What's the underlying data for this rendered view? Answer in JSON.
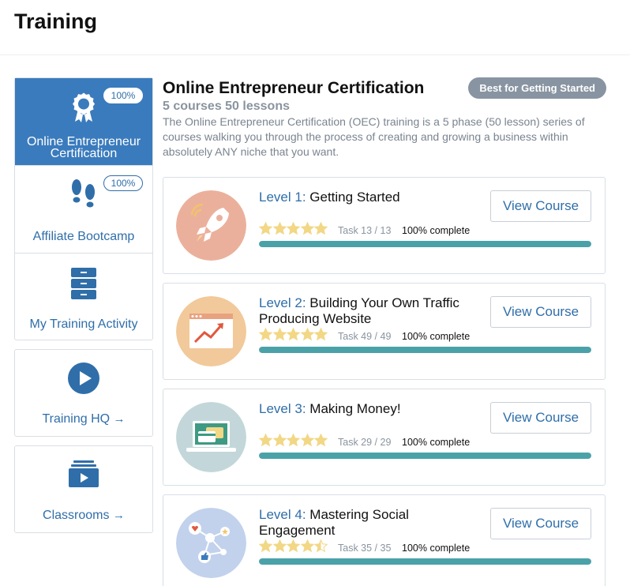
{
  "page": {
    "title": "Training"
  },
  "sidebar": {
    "items": [
      {
        "label": "Online Entrepreneur Certification",
        "badge": "100%",
        "icon": "award-ribbon-icon",
        "active": true
      },
      {
        "label": "Affiliate Bootcamp",
        "badge": "100%",
        "icon": "footprints-icon",
        "active": false
      },
      {
        "label": "My Training Activity",
        "icon": "file-cabinet-icon",
        "active": false
      }
    ],
    "links": [
      {
        "label": "Training HQ",
        "arrow": "→",
        "icon": "play-circle-icon"
      },
      {
        "label": "Classrooms",
        "arrow": "→",
        "icon": "video-stack-icon"
      }
    ]
  },
  "certification": {
    "title": "Online Entrepreneur Certification",
    "badge": "Best for Getting Started",
    "subtitle": "5 courses 50 lessons",
    "description": "The Online Entrepreneur Certification (OEC) training is a 5 phase (50 lesson) series of courses walking you through the process of creating and growing a business within absolutely ANY niche that you want."
  },
  "courses": [
    {
      "level": "Level 1:",
      "name": "Getting Started",
      "button": "View Course",
      "task": "Task 13 / 13",
      "complete": "100% complete",
      "progress": 1.0,
      "rating": 5,
      "icon": "rocket-icon",
      "icon_color": "#ebb09c"
    },
    {
      "level": "Level 2:",
      "name": "Building Your Own Traffic Producing Website",
      "button": "View Course",
      "task": "Task 49 / 49",
      "complete": "100% complete",
      "progress": 1.0,
      "rating": 5,
      "icon": "browser-chart-icon",
      "icon_color": "#f2c99a"
    },
    {
      "level": "Level 3:",
      "name": "Making Money!",
      "button": "View Course",
      "task": "Task 29 / 29",
      "complete": "100% complete",
      "progress": 1.0,
      "rating": 5,
      "icon": "laptop-card-icon",
      "icon_color": "#c3d7da"
    },
    {
      "level": "Level 4:",
      "name": "Mastering Social Engagement",
      "button": "View Course",
      "task": "Task 35 / 35",
      "complete": "100% complete",
      "progress": 1.0,
      "rating": 4.5,
      "icon": "social-network-icon",
      "icon_color": "#c2d2ec"
    }
  ],
  "colors": {
    "accent": "#3a7bbd",
    "link": "#2f6ea9",
    "progress": "#4aa2a8",
    "star": "#f2d785",
    "badge_bg": "#8894a1"
  }
}
